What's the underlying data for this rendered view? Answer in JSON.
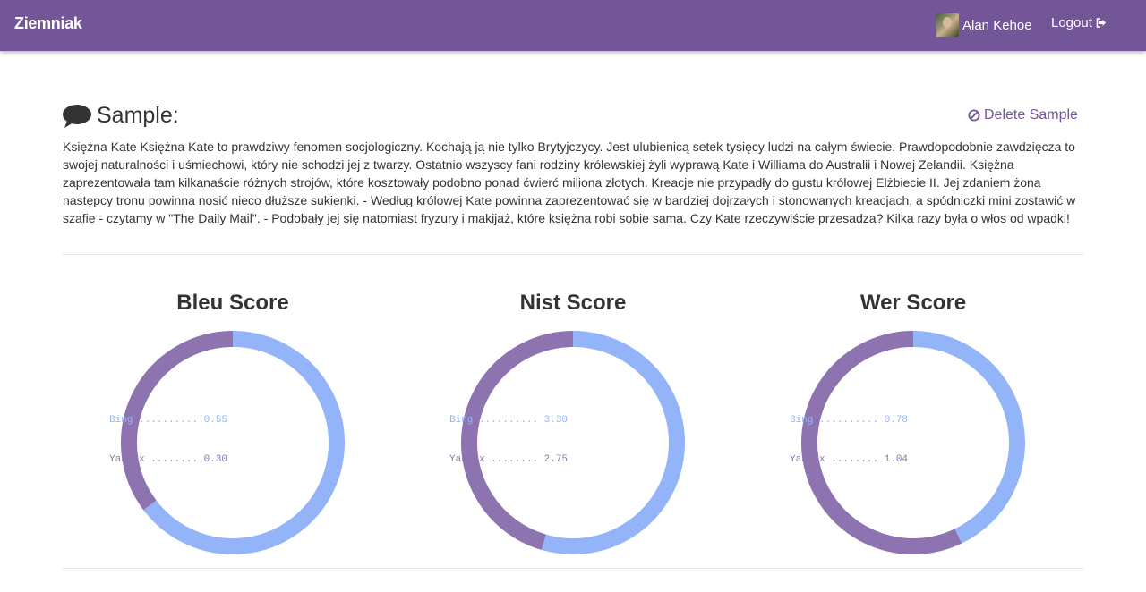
{
  "navbar": {
    "brand": "Ziemniak",
    "user_name": "Alan Kehoe",
    "logout_label": "Logout"
  },
  "sample": {
    "heading": "Sample:",
    "delete_label": "Delete Sample",
    "text": "Księżna Kate Księżna Kate to prawdziwy fenomen socjologiczny. Kochają ją nie tylko Brytyjczycy. Jest ulubienicą setek tysięcy ludzi na całym świecie. Prawdopodobnie zawdzięcza to swojej naturalności i uśmiechowi, który nie schodzi jej z twarzy. Ostatnio wszyscy fani rodziny królewskiej żyli wyprawą Kate i Williama do Australii i Nowej Zelandii. Księżna zaprezentowała tam kilkanaście różnych strojów, które kosztowały podobno ponad ćwierć miliona złotych. Kreacje nie przypadły do gustu królowej Elżbiecie II. Jej zdaniem żona następcy tronu powinna nosić nieco dłuższe sukienki. - Według królowej Kate powinna zaprezentować się w bardziej dojrzałych i stonowanych kreacjach, a spódniczki mini zostawić w szafie - czytamy w \"The Daily Mail\". - Podobały jej się natomiast fryzury i makijaż, które księżna robi sobie sama. Czy Kate rzeczywiście przesadza? Kilka razy była o włos od wpadki!"
  },
  "colors": {
    "brand": "#735698",
    "bing": "#93b4f9",
    "yandex": "#8d73b0"
  },
  "chart_data": [
    {
      "type": "pie",
      "title": "Bleu Score",
      "series": [
        {
          "name": "Bing",
          "value": 0.55,
          "label": "Bing .......... 0.55"
        },
        {
          "name": "Yandex",
          "value": 0.3,
          "label": "Yandex ........ 0.30"
        }
      ]
    },
    {
      "type": "pie",
      "title": "Nist Score",
      "series": [
        {
          "name": "Bing",
          "value": 3.3,
          "label": "Bing .......... 3.30"
        },
        {
          "name": "Yandex",
          "value": 2.75,
          "label": "Yandex ........ 2.75"
        }
      ]
    },
    {
      "type": "pie",
      "title": "Wer Score",
      "series": [
        {
          "name": "Bing",
          "value": 0.78,
          "label": "Bing .......... 0.78"
        },
        {
          "name": "Yandex",
          "value": 1.04,
          "label": "Yandex ........ 1.04"
        }
      ]
    }
  ]
}
